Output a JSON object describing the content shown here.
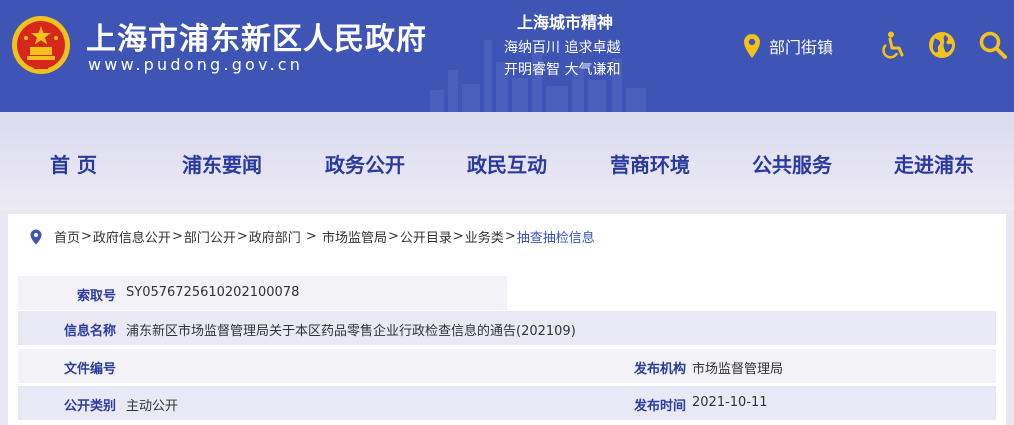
{
  "header": {
    "emblem": "national-emblem",
    "site_title": "上海市浦东新区人民政府",
    "site_url": "www.pudong.gov.cn",
    "spirit_title": "上海城市精神",
    "spirit_line1": "海纳百川  追求卓越",
    "spirit_line2": "开明睿智  大气谦和",
    "dept_label": "部门街镇",
    "icons": [
      "location-pin-icon",
      "accessibility-icon",
      "globe-icon",
      "search-icon"
    ],
    "colors": {
      "header_bg": "#3f55b6",
      "icon_gold": "#f4c318",
      "nav_text": "#2a3a9e"
    }
  },
  "nav": {
    "items": [
      "首  页",
      "浦东要闻",
      "政务公开",
      "政民互动",
      "营商环境",
      "公共服务",
      "走进浦东"
    ]
  },
  "breadcrumb": {
    "items": [
      "首页",
      "政府信息公开",
      "部门公开",
      "政府部门",
      "市场监管局",
      "公开目录",
      "业务类",
      "抽查抽检信息"
    ],
    "separators": [
      ">",
      ">",
      ">",
      " > ",
      ">",
      ">",
      ">"
    ]
  },
  "meta": {
    "index_label": "索取号",
    "index_value": "SY0576725610202100078",
    "name_label": "信息名称",
    "name_value": "浦东新区市场监督管理局关于本区药品零售企业行政检查信息的通告(202109)",
    "doc_no_label": "文件编号",
    "doc_no_value": "",
    "publisher_label": "发布机构",
    "publisher_value": "市场监督管理局",
    "category_label": "公开类别",
    "category_value": "主动公开",
    "date_label": "发布时间",
    "date_value": "2021-10-11"
  }
}
